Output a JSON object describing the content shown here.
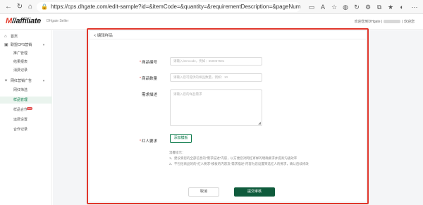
{
  "browser": {
    "url": "https://cps.dhgate.com/edit-sample?id=&itemCode=&quantity=&requirementDescription=&pageNum=1&p..."
  },
  "header": {
    "logo_mark": "M",
    "logo_text": "//affiliate",
    "logo_sub": "DHgate Seller",
    "welcome_prefix": "欢迎您到DHgate",
    "welcome_suffix": "欢迎您"
  },
  "sidebar": {
    "items": [
      {
        "label": "首页",
        "icon": "home-icon"
      },
      {
        "label": "联盟CPS营销",
        "icon": "link-icon"
      },
      {
        "label": "推广管理"
      },
      {
        "label": "结果报表"
      },
      {
        "label": "消费记录"
      },
      {
        "label": "网红营销广告",
        "icon": "star-icon"
      },
      {
        "label": "网红筛选"
      },
      {
        "label": "样品管理"
      },
      {
        "label": "样品合作",
        "badge": "new"
      },
      {
        "label": "运费设置"
      },
      {
        "label": "合作记录"
      }
    ]
  },
  "card": {
    "title": "< 编辑样品"
  },
  "form": {
    "product_code_label": "商品编号",
    "product_code_placeholder": "请输入itemcode，例如：650067591",
    "quantity_label": "商品数量",
    "quantity_placeholder": "请输入您可提供的样品数量，例如：10",
    "requirement_label": "需求描述",
    "requirement_placeholder": "请输入您的样品需求",
    "influencer_label": "红人要求",
    "add_template_label": "添加模板",
    "tips": [
      "温馨提示：",
      "1、建议将您的全部信息的\"需求描述\"内容，以方便您对网红寄样的明确要求并提高沟通效率",
      "2、不包括商品的的\"红人要求\"模板的内容及\"需求描述\"内容为您设置筛选红人的要求，确认后续修改"
    ]
  },
  "actions": {
    "cancel_label": "取消",
    "submit_label": "提交审核"
  }
}
